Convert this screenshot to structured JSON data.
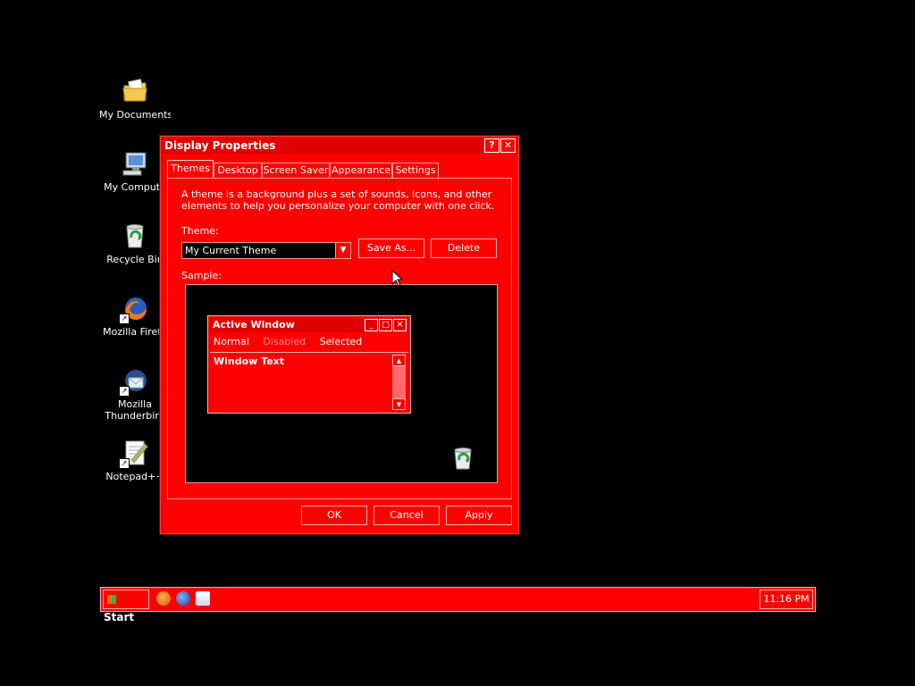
{
  "desktop": {
    "icons": [
      {
        "label": "My Documents",
        "icon": "folder-documents-icon"
      },
      {
        "label": "My Compute",
        "icon": "computer-icon"
      },
      {
        "label": "Recycle Bin",
        "icon": "recycle-bin-icon"
      },
      {
        "label": "Mozilla Firefo",
        "icon": "firefox-icon"
      },
      {
        "label": "Mozilla",
        "label2": "Thunderbird",
        "icon": "thunderbird-icon"
      },
      {
        "label": "Notepad++",
        "icon": "notepad-icon"
      }
    ]
  },
  "dialog": {
    "title": "Display Properties",
    "help_glyph": "?",
    "close_glyph": "✕",
    "tabs": [
      "Themes",
      "Desktop",
      "Screen Saver",
      "Appearance",
      "Settings"
    ],
    "active_tab": "Themes",
    "description": "A theme is a background plus a set of sounds, icons, and other elements to help you personalize your computer with one click.",
    "theme_label": "Theme:",
    "theme_value": "My Current Theme",
    "save_as_label": "Save As...",
    "delete_label": "Delete",
    "sample_label": "Sample:",
    "sample": {
      "window_title": "Active Window",
      "menu": [
        "Normal",
        "Disabled",
        "Selected"
      ],
      "window_text": "Window Text"
    },
    "ok_label": "OK",
    "cancel_label": "Cancel",
    "apply_label": "Apply"
  },
  "taskbar": {
    "start_label": "Start",
    "quick_launch": [
      "firefox-icon",
      "thunderbird-icon",
      "notepad-icon"
    ],
    "clock": "11:16 PM"
  },
  "colors": {
    "theme_red": "#ff0000",
    "desktop": "#000000",
    "text": "#ffffff"
  }
}
